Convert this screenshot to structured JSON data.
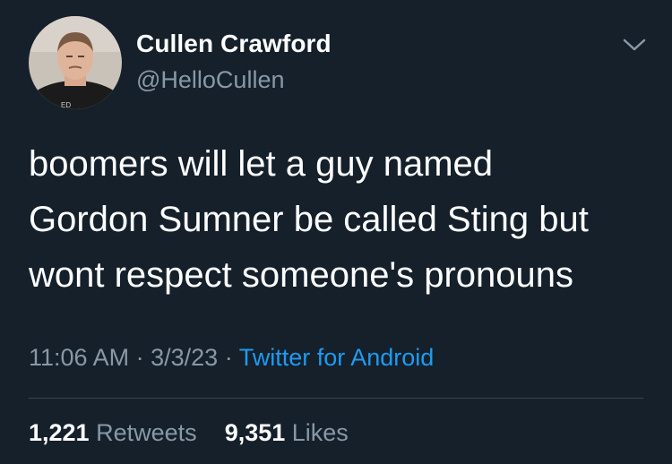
{
  "user": {
    "display_name": "Cullen Crawford",
    "handle": "@HelloCullen",
    "avatar_icon": "profile-photo"
  },
  "tweet": {
    "lines": [
      "boomers will let a guy named",
      "Gordon Sumner be called Sting but",
      "wont respect someone's pronouns"
    ],
    "time": "11:06 AM",
    "date": "3/3/23",
    "separator": "·",
    "source": "Twitter for Android"
  },
  "stats": {
    "retweets_count": "1,221",
    "retweets_label": "Retweets",
    "likes_count": "9,351",
    "likes_label": "Likes"
  },
  "icons": {
    "more": "chevron-down-icon"
  },
  "colors": {
    "background": "#15202b",
    "text_primary": "#ffffff",
    "text_secondary": "#8899a6",
    "link": "#1d9bf0",
    "divider": "#38444d"
  }
}
